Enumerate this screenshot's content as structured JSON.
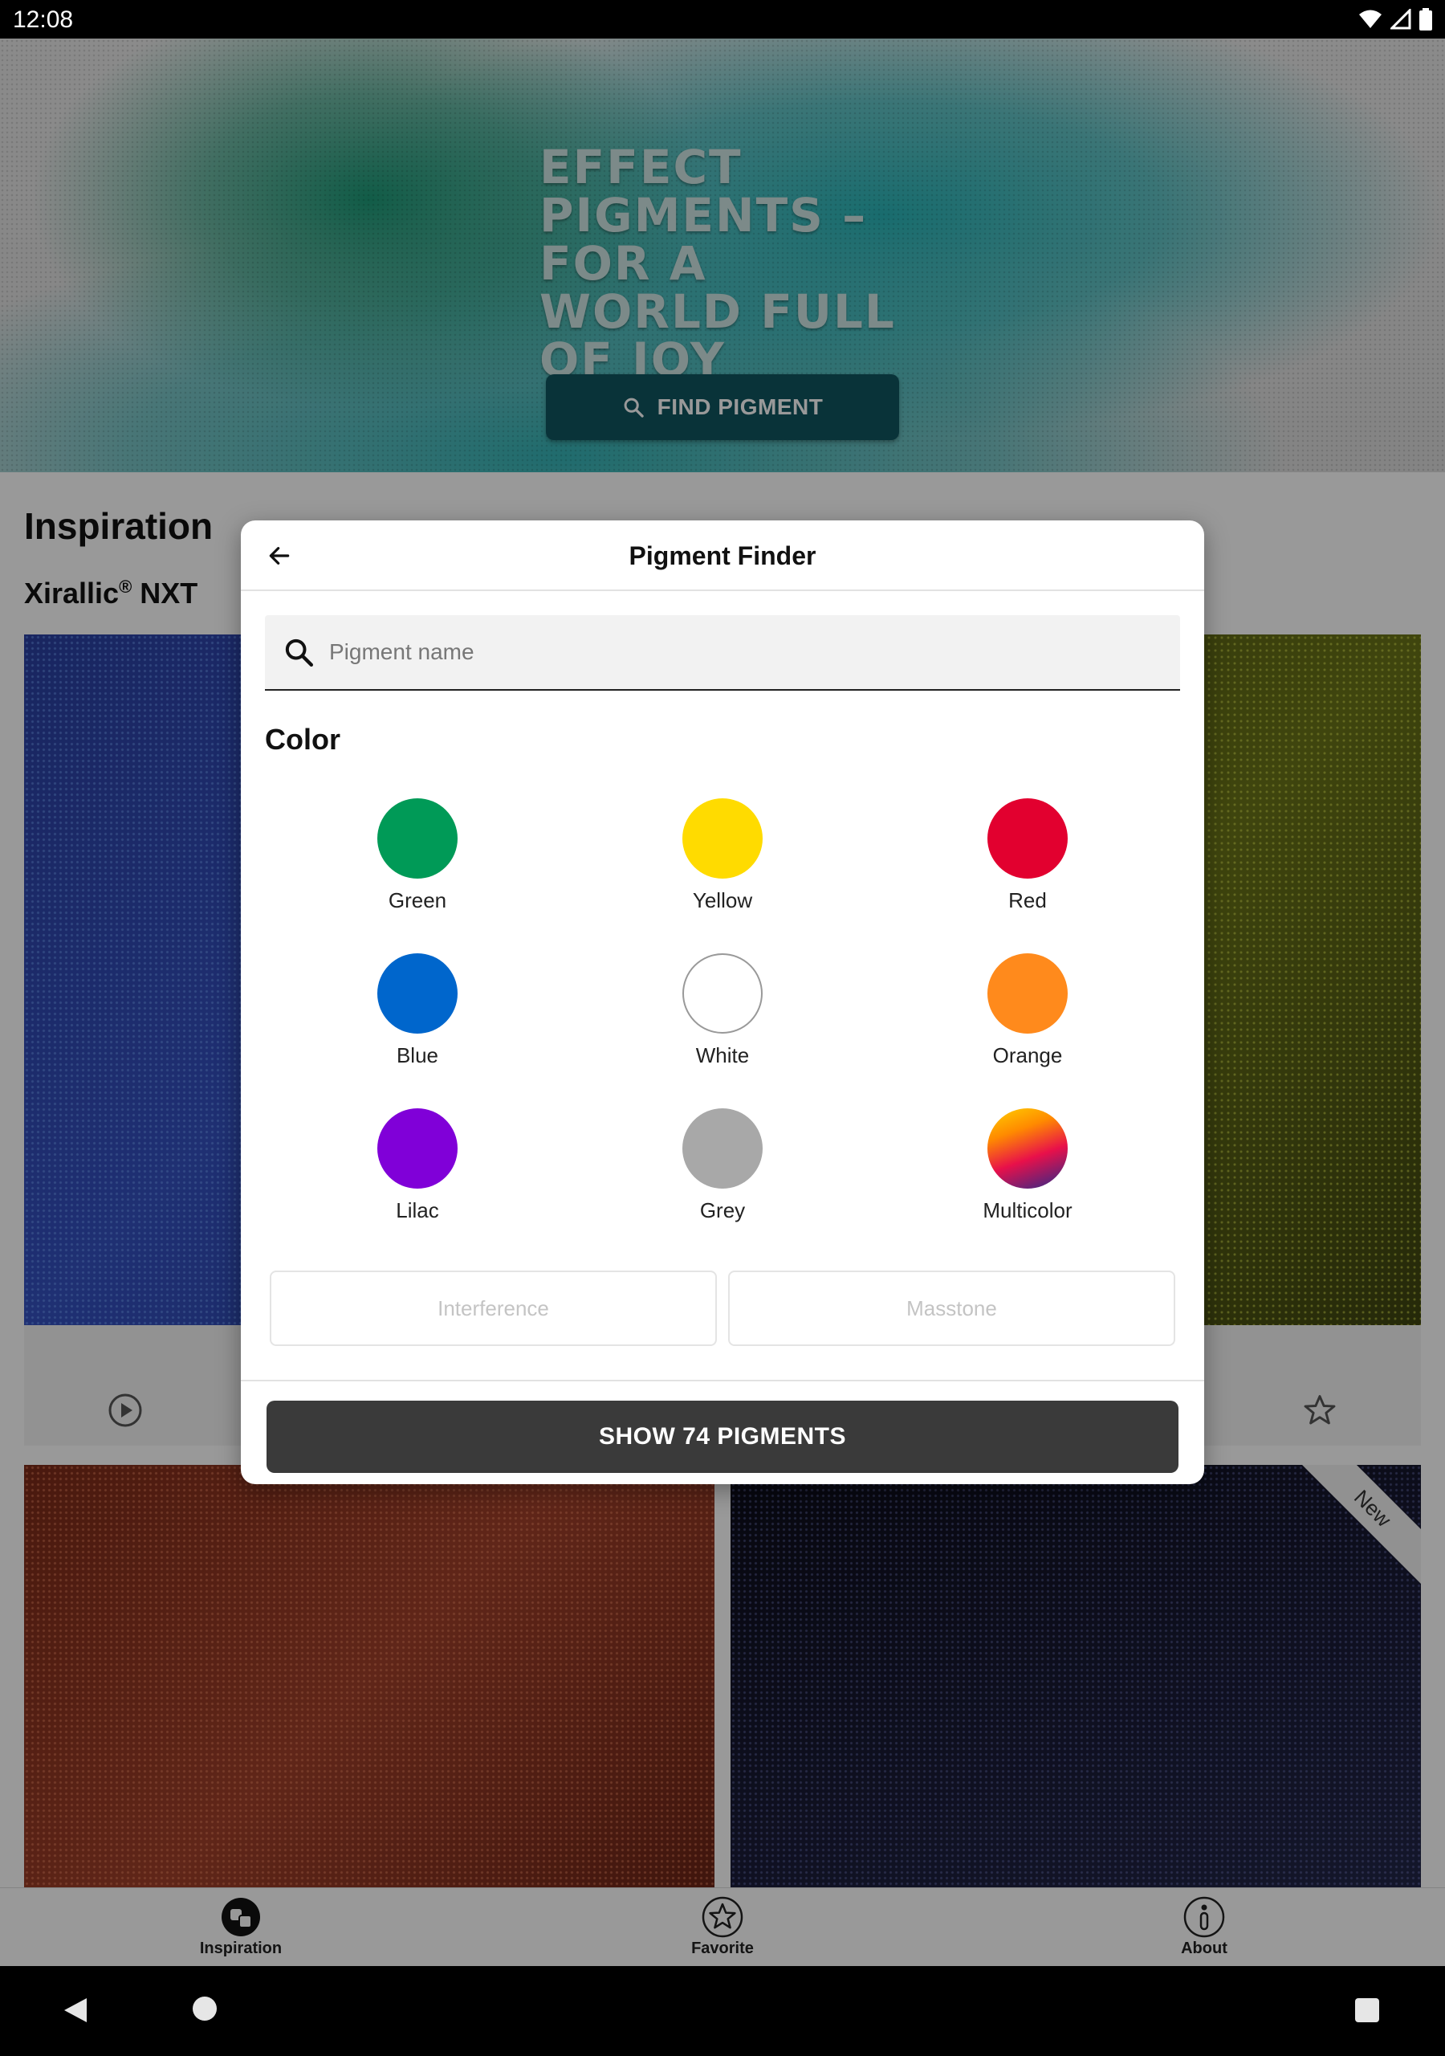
{
  "status_bar": {
    "time": "12:08",
    "icons": [
      "wifi-icon",
      "signal-icon",
      "battery-icon"
    ]
  },
  "hero": {
    "title": "EFFECT PIGMENTS – FOR A WORLD FULL OF JOY",
    "find_button_label": "FIND PIGMENT",
    "find_button_icon": "search-icon"
  },
  "background": {
    "section_title": "Inspiration",
    "series_name": "Xirallic",
    "series_mark": "®",
    "series_suffix": " NXT",
    "new_badge": "New"
  },
  "dialog": {
    "back_icon": "arrow-left-icon",
    "title": "Pigment Finder",
    "search_placeholder": "Pigment name",
    "color_heading": "Color",
    "colors": [
      {
        "label": "Green",
        "color": "#009a57"
      },
      {
        "label": "Yellow",
        "color": "#ffdb00"
      },
      {
        "label": "Red",
        "color": "#e2002f"
      },
      {
        "label": "Blue",
        "color": "#0066cc"
      },
      {
        "label": "White",
        "color": "#ffffff"
      },
      {
        "label": "Orange",
        "color": "#ff8a1c"
      },
      {
        "label": "Lilac",
        "color": "#8000d8"
      },
      {
        "label": "Grey",
        "color": "#a8a8a8"
      },
      {
        "label": "Multicolor",
        "color": "gradient"
      }
    ],
    "chips": [
      "Interference",
      "Masstone"
    ],
    "show_button_label": "SHOW 74 PIGMENTS"
  },
  "bottom_nav": {
    "items": [
      {
        "label": "Inspiration",
        "icon": "inspiration-icon"
      },
      {
        "label": "Favorite",
        "icon": "star-icon"
      },
      {
        "label": "About",
        "icon": "info-icon"
      }
    ]
  },
  "system_nav": {
    "icons": [
      "back-triangle-icon",
      "home-circle-icon",
      "recents-square-icon"
    ]
  }
}
